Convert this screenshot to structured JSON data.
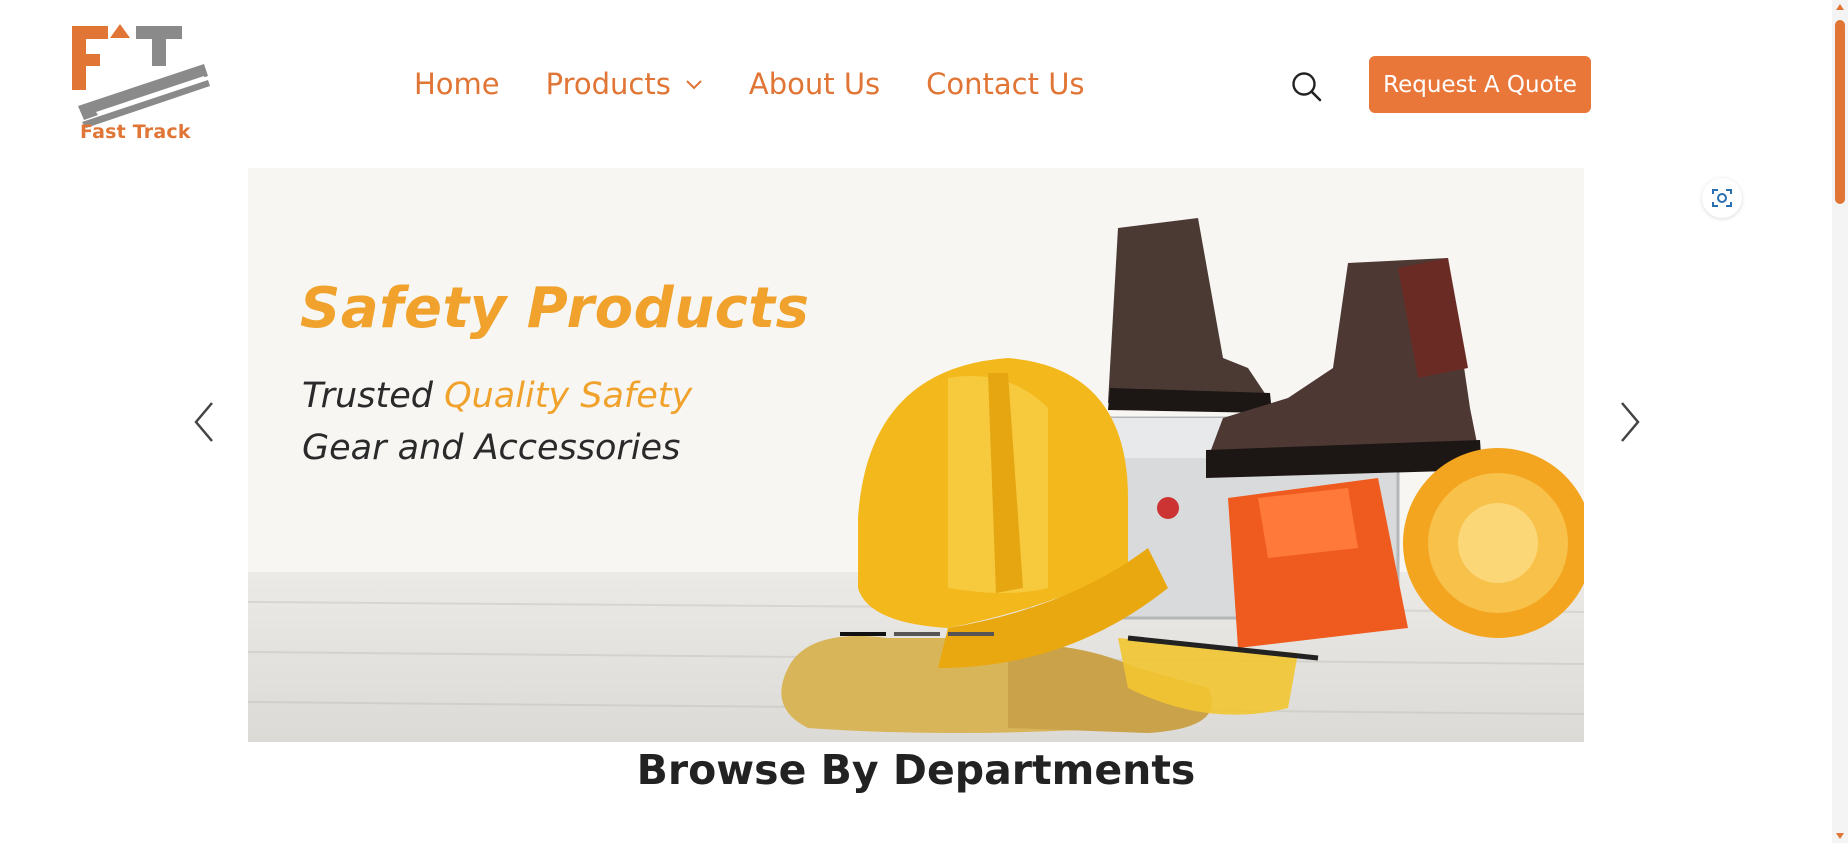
{
  "brand": {
    "logo_text": "Fast Track",
    "logo_icon": "fast-track-logo",
    "accent_color": "#e07535"
  },
  "nav": {
    "items": [
      {
        "label": "Home"
      },
      {
        "label": "Products",
        "has_dropdown": true
      },
      {
        "label": "About Us"
      },
      {
        "label": "Contact Us"
      }
    ]
  },
  "header": {
    "search_icon": "search-icon",
    "quote_button": "Request A Quote",
    "quote_color": "#e9773a"
  },
  "carousel": {
    "slide": {
      "title": "Safety Products",
      "subtitle_part1": "Trusted ",
      "subtitle_accent": "Quality Safety",
      "subtitle_line2": "Gear and Accessories"
    },
    "indicators": 3,
    "active_index": 0
  },
  "section": {
    "title": "Browse By Departments"
  }
}
